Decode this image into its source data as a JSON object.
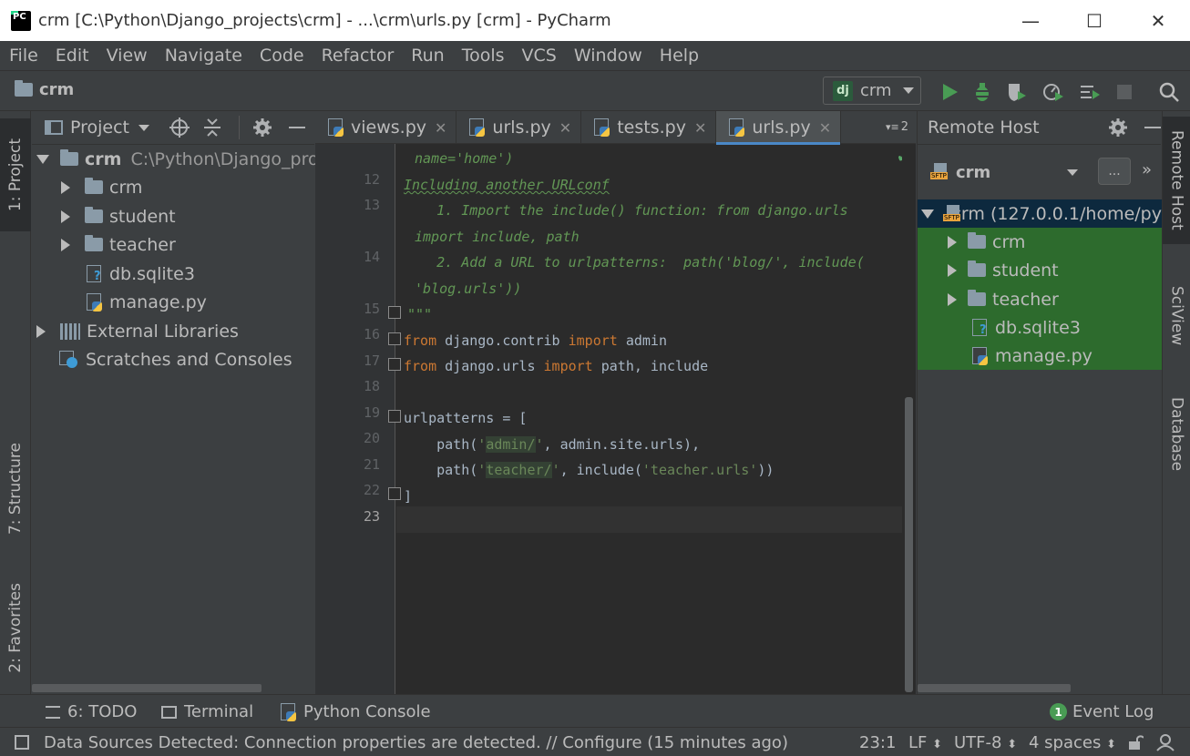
{
  "window": {
    "title": "crm [C:\\Python\\Django_projects\\crm] - ...\\crm\\urls.py [crm] - PyCharm",
    "minimize": "—",
    "maximize": "☐",
    "close": "✕"
  },
  "menu": [
    "File",
    "Edit",
    "View",
    "Navigate",
    "Code",
    "Refactor",
    "Run",
    "Tools",
    "VCS",
    "Window",
    "Help"
  ],
  "navbar": {
    "breadcrumb": "crm",
    "run_config": "crm",
    "run_config_icon": "dj"
  },
  "left_strip": {
    "project_tab": "1: Project",
    "structure_tab": "7: Structure",
    "favorites_tab": "2: Favorites"
  },
  "right_strip": {
    "remote_host_tab": "Remote Host",
    "sciview_tab": "SciView",
    "database_tab": "Database"
  },
  "project_panel": {
    "title": "Project",
    "root": {
      "name": "crm",
      "path": "C:\\Python\\Django_proje"
    },
    "items": [
      {
        "label": "crm",
        "kind": "folder"
      },
      {
        "label": "student",
        "kind": "folder"
      },
      {
        "label": "teacher",
        "kind": "folder"
      },
      {
        "label": "db.sqlite3",
        "kind": "db"
      },
      {
        "label": "manage.py",
        "kind": "python"
      }
    ],
    "external_libraries": "External Libraries",
    "scratches": "Scratches and Consoles"
  },
  "editor": {
    "tabs": [
      {
        "label": "views.py",
        "active": false
      },
      {
        "label": "urls.py",
        "active": false
      },
      {
        "label": "tests.py",
        "active": false
      },
      {
        "label": "urls.py",
        "active": true
      }
    ],
    "tab_overflow": "2",
    "line_numbers": [
      "12",
      "13",
      "14",
      "15",
      "16",
      "17",
      "18",
      "19",
      "20",
      "21",
      "22",
      "23"
    ],
    "current_line": "23",
    "code": {
      "l11_cont": "name='home')",
      "l12": "Including another URLconf",
      "l13a": "    1. Import the include() function: from django.urls",
      "l13b": "import include, path",
      "l14a": "    2. Add a URL to urlpatterns:  path('blog/', include(",
      "l14b": "'blog.urls'))",
      "l15": "\"\"\"",
      "l16_kw1": "from",
      "l16_mod": " django.contrib ",
      "l16_kw2": "import",
      "l16_name": " admin",
      "l17_kw1": "from",
      "l17_mod": " django.urls ",
      "l17_kw2": "import",
      "l17_name": " path, include",
      "l19": "urlpatterns = [",
      "l20_a": "    path(",
      "l20_q1": "'",
      "l20_s": "admin/",
      "l20_q2": "'",
      "l20_b": ", admin.site.urls),",
      "l21_a": "    path(",
      "l21_q1": "'",
      "l21_s": "teacher/",
      "l21_q2": "'",
      "l21_b": ", include(",
      "l21_s2": "'teacher.urls'",
      "l21_c": "))",
      "l22": "]"
    }
  },
  "remote_panel": {
    "title": "Remote Host",
    "server": "crm",
    "browse_button": "...",
    "root": "crm (127.0.0.1/home/py",
    "items": [
      {
        "label": "crm",
        "kind": "folder"
      },
      {
        "label": "student",
        "kind": "folder"
      },
      {
        "label": "teacher",
        "kind": "folder"
      },
      {
        "label": "db.sqlite3",
        "kind": "db"
      },
      {
        "label": "manage.py",
        "kind": "python"
      }
    ]
  },
  "bottom_tools": {
    "todo": "6: TODO",
    "terminal": "Terminal",
    "python_console": "Python Console",
    "event_log": "Event Log",
    "event_count": "1"
  },
  "status": {
    "message": "Data Sources Detected: Connection properties are detected. // Configure (15 minutes ago)",
    "position": "23:1",
    "line_sep": "LF",
    "encoding": "UTF-8",
    "indent": "4 spaces"
  },
  "colors": {
    "accent": "#4a88c7",
    "run_green": "#499c54",
    "remote_selection": "#2d6b2d"
  }
}
